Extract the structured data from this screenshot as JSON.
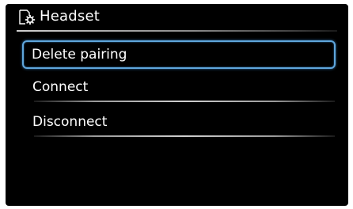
{
  "header": {
    "title": "Headset",
    "icon": "headset-settings-icon"
  },
  "menu": {
    "items": [
      {
        "label": "Delete pairing",
        "selected": true
      },
      {
        "label": "Connect",
        "selected": false
      },
      {
        "label": "Disconnect",
        "selected": false
      }
    ]
  },
  "colors": {
    "background": "#000000",
    "text": "#ffffff",
    "selection_border": "#5fa6dc"
  }
}
